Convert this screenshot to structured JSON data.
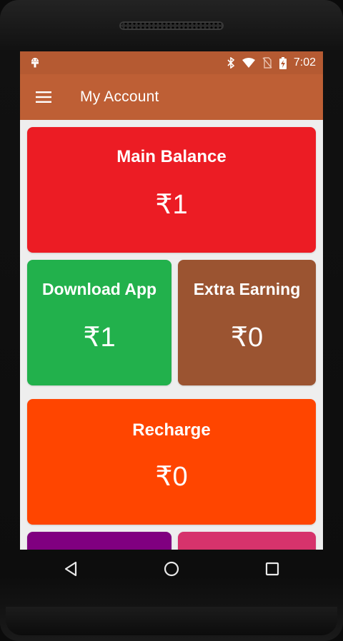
{
  "status_bar": {
    "time": "7:02",
    "icons": [
      "android-debug-icon",
      "bluetooth-icon",
      "wifi-icon",
      "no-sim-icon",
      "battery-charging-icon"
    ]
  },
  "app_bar": {
    "title": "My Account",
    "menu_icon": "hamburger-menu-icon"
  },
  "cards": {
    "main_balance": {
      "label": "Main Balance",
      "amount": "₹1",
      "color": "#ec1c24"
    },
    "download_app": {
      "label": "Download App",
      "amount": "₹1",
      "color": "#22b14c"
    },
    "extra_earning": {
      "label": "Extra Earning",
      "amount": "₹0",
      "color": "#9b5431"
    },
    "recharge": {
      "label": "Recharge",
      "amount": "₹0",
      "color": "#ff4500"
    },
    "partial_left": {
      "color": "#800080"
    },
    "partial_right": {
      "color": "#d6336c"
    }
  },
  "nav_bar": {
    "back": "back-icon",
    "home": "home-icon",
    "recents": "recents-icon"
  },
  "colors": {
    "status_bar": "#b55a32",
    "app_bar": "#be5f35",
    "screen_bg": "#eeeeee"
  }
}
